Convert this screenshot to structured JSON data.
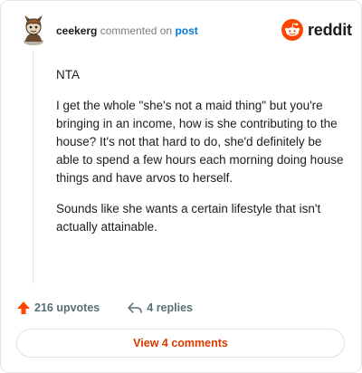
{
  "comment": {
    "username": "ceekerg",
    "action": "commented on",
    "target": "post",
    "paragraphs": [
      "NTA",
      "I get the whole \"she's not a maid thing\" but you're bringing in an income, how is she contributing to the house? It's not that hard to do, she'd definitely be able to spend a few hours each morning doing house things and have arvos to herself.",
      "Sounds like she wants a certain lifestyle that isn't actually attainable."
    ]
  },
  "brand": {
    "name": "reddit",
    "color": "#ff4500"
  },
  "stats": {
    "upvotes": "216 upvotes",
    "replies": "4 replies"
  },
  "footer": {
    "view_label": "View 4 comments"
  },
  "icons": {
    "avatar": "avatar",
    "logo": "reddit-logo-icon",
    "upvote": "upvote-arrow-icon",
    "reply": "reply-arrow-icon"
  }
}
